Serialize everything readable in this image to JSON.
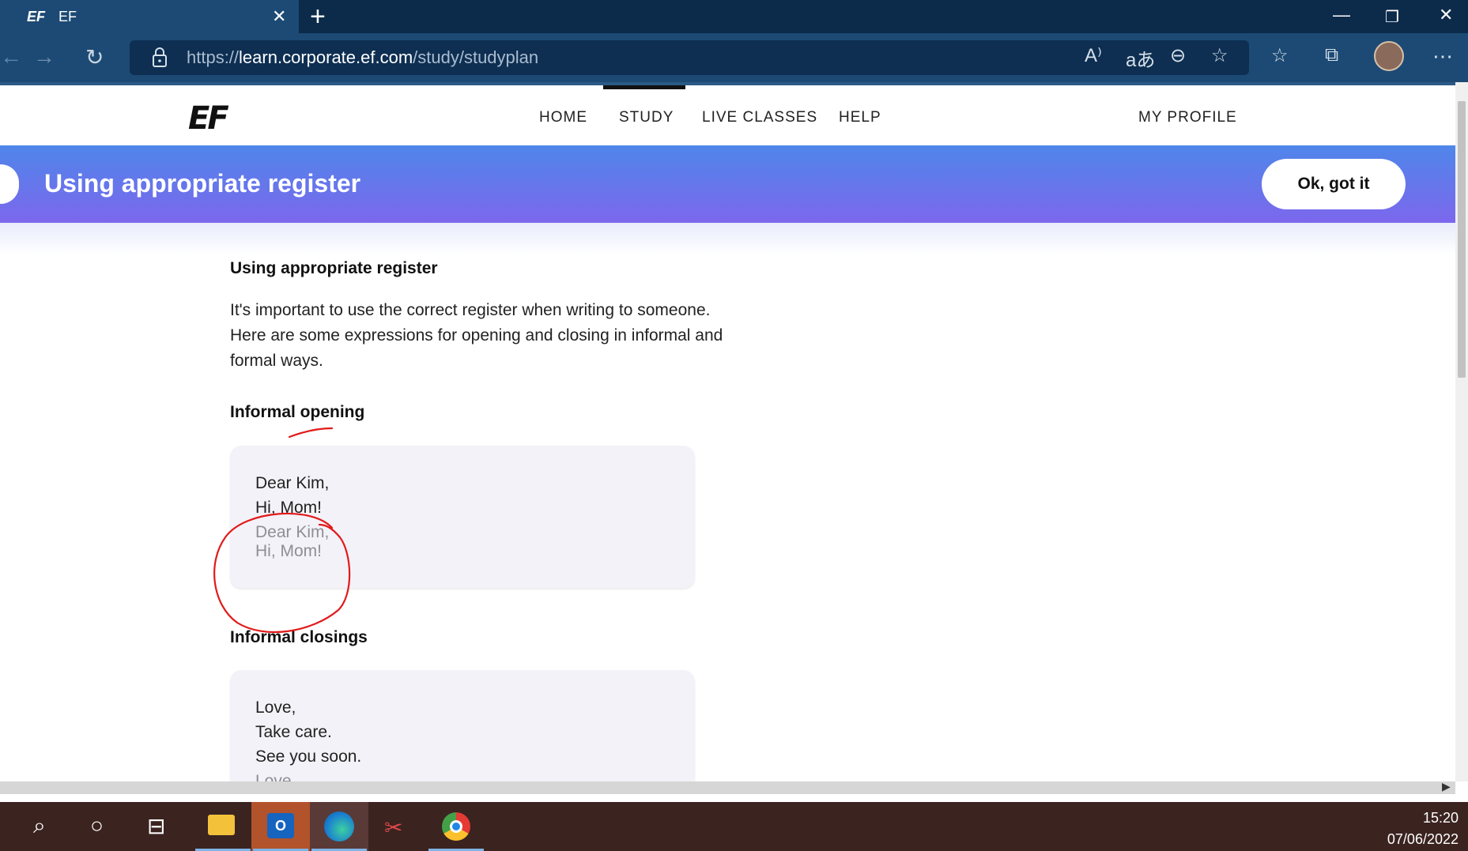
{
  "browser": {
    "tab": {
      "favicon_text": "EF",
      "title": "EF"
    },
    "url_prefix": "https://",
    "url_domain": "learn.corporate.ef.com",
    "url_path": "/study/studyplan"
  },
  "site": {
    "logo": "EF",
    "nav": {
      "home": "HOME",
      "study": "STUDY",
      "live_classes": "LIVE CLASSES",
      "help": "HELP",
      "profile": "MY PROFILE"
    },
    "active_nav": "STUDY"
  },
  "banner": {
    "title": "Using appropriate register",
    "ok_button": "Ok, got it"
  },
  "content": {
    "heading": "Using appropriate register",
    "paragraph_lines": [
      "It's important to use the correct register when writing to someone.",
      "Here are some expressions for opening and closing in informal and",
      "formal ways."
    ],
    "informal_opening": {
      "heading": "Informal opening",
      "lines": [
        "Dear Kim,",
        "Hi, Mom!"
      ],
      "faded_lines": [
        "Dear Kim,",
        "Hi, Mom!"
      ]
    },
    "informal_closings": {
      "heading": "Informal closings",
      "lines": [
        "Love,",
        "Take care.",
        "See you soon."
      ],
      "faded_lines": [
        "Love"
      ]
    }
  },
  "taskbar": {
    "time": "15:20",
    "date": "07/06/2022"
  },
  "colors": {
    "banner_start": "#4f86ea",
    "banner_end": "#7c67ec",
    "annotation": "#e11a1a"
  }
}
